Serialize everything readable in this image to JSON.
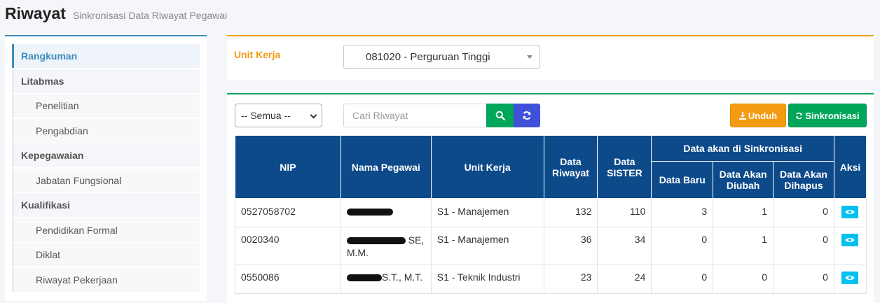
{
  "header": {
    "title": "Riwayat",
    "subtitle": "Sinkronisasi Data Riwayat Pegawai"
  },
  "sidebar": {
    "items": [
      {
        "label": "Rangkuman",
        "type": "category",
        "active": true
      },
      {
        "label": "Litabmas",
        "type": "category"
      },
      {
        "label": "Penelitian",
        "type": "sub"
      },
      {
        "label": "Pengabdian",
        "type": "sub"
      },
      {
        "label": "Kepegawaian",
        "type": "category"
      },
      {
        "label": "Jabatan Fungsional",
        "type": "sub"
      },
      {
        "label": "Kualifikasi",
        "type": "category"
      },
      {
        "label": "Pendidikan Formal",
        "type": "sub"
      },
      {
        "label": "Diklat",
        "type": "sub"
      },
      {
        "label": "Riwayat Pekerjaan",
        "type": "sub"
      }
    ]
  },
  "unit": {
    "label": "Unit Kerja",
    "selected": "081020 - Perguruan Tinggi"
  },
  "toolbar": {
    "filter_selected": "-- Semua --",
    "search_placeholder": "Cari Riwayat",
    "unduh_label": "Unduh",
    "sinkron_label": "Sinkronisasi"
  },
  "table": {
    "headers": {
      "nip": "NIP",
      "nama": "Nama Pegawai",
      "unit": "Unit Kerja",
      "riwayat": "Data Riwayat",
      "sister": "Data SISTER",
      "group": "Data akan di Sinkronisasi",
      "baru": "Data Baru",
      "diubah": "Data Akan Diubah",
      "dihapus": "Data Akan Dihapus",
      "aksi": "Aksi"
    },
    "rows": [
      {
        "nip": "0527058702",
        "nama_suffix": "",
        "unit": "S1 - Manajemen",
        "riwayat": "132",
        "sister": "110",
        "baru": "3",
        "diubah": "1",
        "dihapus": "0"
      },
      {
        "nip": "0020340",
        "nama_suffix": "SE, M.M.",
        "unit": "S1 - Manajemen",
        "riwayat": "36",
        "sister": "34",
        "baru": "0",
        "diubah": "1",
        "dihapus": "0"
      },
      {
        "nip": "0550086",
        "nama_suffix": "S.T., M.T.",
        "unit": "S1 - Teknik Industri",
        "riwayat": "23",
        "sister": "24",
        "baru": "0",
        "diubah": "0",
        "dihapus": "0"
      }
    ]
  },
  "icons": {
    "search": "search-icon",
    "refresh": "refresh-icon",
    "download": "download-icon",
    "view": "eye-icon"
  },
  "colors": {
    "accent_blue": "#3c8dbc",
    "warning": "#f39c12",
    "success": "#00a65a",
    "table_header": "#0d4a8a",
    "info": "#00c0ef",
    "refresh_button": "#3f51d9"
  }
}
